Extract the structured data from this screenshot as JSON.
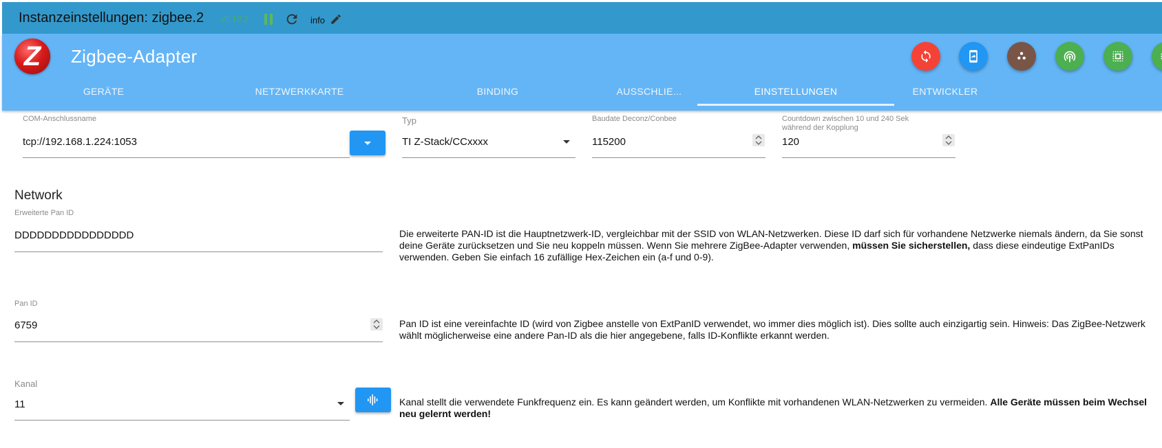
{
  "topbar": {
    "title": "Instanzeinstellungen: zigbee.2",
    "version": "v1.10.2",
    "info_label": "info"
  },
  "header": {
    "logo_letter": "Z",
    "title": "Zigbee-Adapter",
    "action_buttons": [
      {
        "icon": "sync-icon",
        "color": "#f44336"
      },
      {
        "icon": "download-icon",
        "color": "#2196f3"
      },
      {
        "icon": "dots-icon",
        "color": "#795548"
      },
      {
        "icon": "radio-signal-icon",
        "color": "#4caf50"
      },
      {
        "icon": "select-area-icon",
        "color": "#4caf50"
      },
      {
        "icon": "list-icon",
        "color": "#4caf50"
      }
    ]
  },
  "tabs": [
    {
      "label": "GERÄTE",
      "active": false
    },
    {
      "label": "NETZWERKKARTE",
      "active": false
    },
    {
      "label": "BINDING",
      "active": false
    },
    {
      "label": "AUSSCHLIE...",
      "active": false
    },
    {
      "label": "EINSTELLUNGEN",
      "active": true
    },
    {
      "label": "ENTWICKLER",
      "active": false
    }
  ],
  "settings": {
    "com_port": {
      "label": "COM-Anschlussname",
      "value": "tcp://192.168.1.224:1053"
    },
    "type": {
      "label": "Typ",
      "value": "TI Z-Stack/CCxxxx"
    },
    "baudrate": {
      "label": "Baudate Deconz/Conbee",
      "value": "115200"
    },
    "countdown": {
      "label_line1": "Countdown zwischen 10 und 240 Sek",
      "label_line2": "während der Kopplung",
      "value": "120"
    }
  },
  "network": {
    "section_title": "Network",
    "ext_pan_id": {
      "label": "Erweiterte Pan ID",
      "value": "DDDDDDDDDDDDDDDD",
      "desc_part1": "Die erweiterte PAN-ID ist die Hauptnetzwerk-ID, vergleichbar mit der SSID von WLAN-Netzwerken. Diese ID darf sich für vorhandene Netzwerke niemals ändern, da Sie sonst deine Geräte zurücksetzen und Sie neu koppeln müssen. Wenn Sie mehrere ZigBee-Adapter verwenden, ",
      "desc_bold": "müssen Sie sicherstellen,",
      "desc_part2": " dass diese eindeutige ExtPanIDs verwenden. Geben Sie einfach 16 zufällige Hex-Zeichen ein (a-f und 0-9)."
    },
    "pan_id": {
      "label": "Pan ID",
      "value": "6759",
      "desc": "Pan ID ist eine vereinfachte ID (wird von Zigbee anstelle von ExtPanID verwendet, wo immer dies möglich ist). Dies sollte auch einzigartig sein. Hinweis: Das ZigBee-Netzwerk wählt möglicherweise eine andere Pan-ID als die hier angegebene, falls ID-Konflikte erkannt werden."
    },
    "channel": {
      "label": "Kanal",
      "value": "11",
      "desc_part1": "Kanal stellt die verwendete Funkfrequenz ein. Es kann geändert werden, um Konflikte mit vorhandenen WLAN-Netzwerken zu vermeiden. ",
      "desc_bold": "Alle Geräte müssen beim Wechsel neu gelernt werden!"
    }
  }
}
